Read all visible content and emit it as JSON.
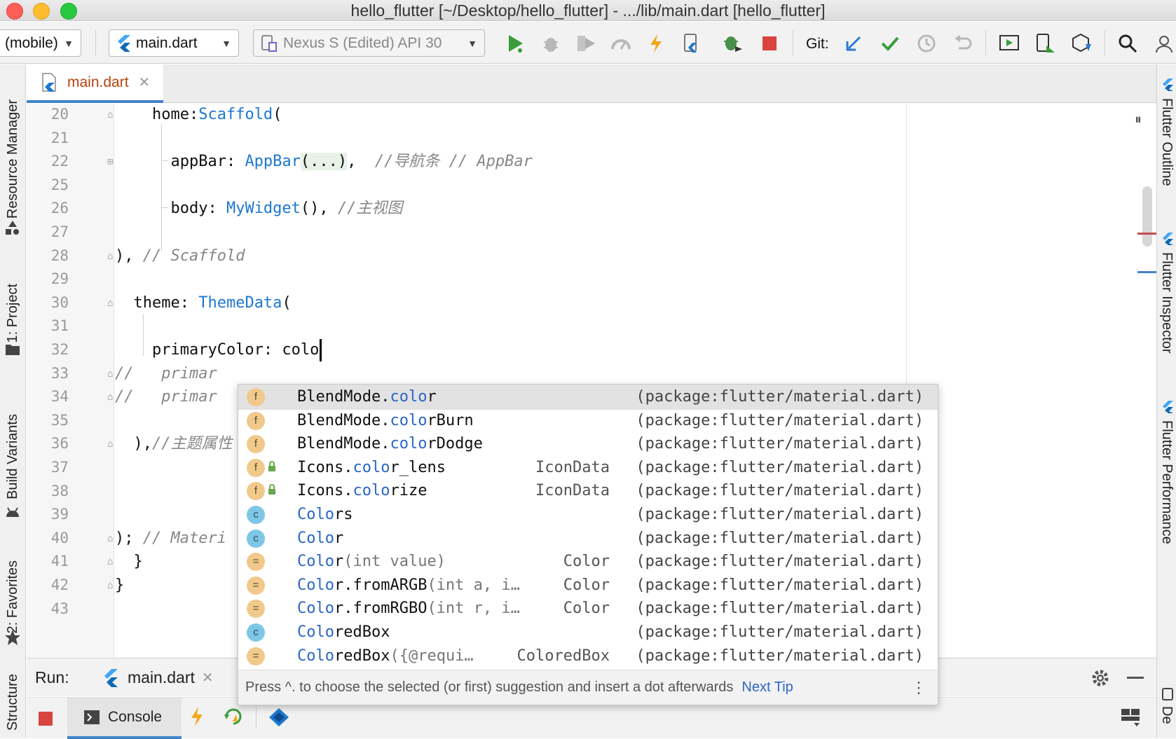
{
  "window": {
    "title": "hello_flutter [~/Desktop/hello_flutter] - .../lib/main.dart [hello_flutter]"
  },
  "toolbar": {
    "device_target": "(mobile)",
    "run_config": "main.dart",
    "device": "Nexus S (Edited) API 30",
    "git_label": "Git:",
    "icons": [
      "run-icon",
      "debug-icon",
      "coverage-icon",
      "profile-icon",
      "hot-reload-icon",
      "flutter-attach-icon",
      "debug-attach-icon",
      "stop-icon",
      "git-update-icon",
      "git-commit-icon",
      "git-history-icon",
      "git-rollback-icon",
      "presentation-icon",
      "device-manager-icon",
      "sdk-manager-icon",
      "search-icon"
    ]
  },
  "left_tools": [
    "Resource Manager",
    "1: Project",
    "Build Variants",
    "2: Favorites",
    "Structure"
  ],
  "right_tools": [
    "Flutter Outline",
    "Flutter Inspector",
    "Flutter Performance",
    "De"
  ],
  "editor": {
    "tab_label": "main.dart",
    "lines": [
      {
        "num": "20",
        "segments": [
          {
            "text": "    home:"
          },
          {
            "text": "Scaffold",
            "cls": "t"
          },
          {
            "text": "("
          }
        ]
      },
      {
        "num": "21",
        "segments": []
      },
      {
        "num": "22",
        "segments": [
          {
            "text": "      appBar: "
          },
          {
            "text": "AppBar",
            "cls": "t"
          },
          {
            "text": "(...)",
            "cls": "f"
          },
          {
            "text": ",  "
          },
          {
            "text": "//导航条 // AppBar",
            "cls": "c"
          }
        ]
      },
      {
        "num": "25",
        "segments": []
      },
      {
        "num": "26",
        "segments": [
          {
            "text": "      body: "
          },
          {
            "text": "MyWidget",
            "cls": "t"
          },
          {
            "text": "(), "
          },
          {
            "text": "//主视图",
            "cls": "c"
          }
        ]
      },
      {
        "num": "27",
        "segments": []
      },
      {
        "num": "28",
        "segments": [
          {
            "text": "), "
          },
          {
            "text": "// Scaffold",
            "cls": "c"
          }
        ]
      },
      {
        "num": "29",
        "segments": []
      },
      {
        "num": "30",
        "segments": [
          {
            "text": "  theme: "
          },
          {
            "text": "ThemeData",
            "cls": "t"
          },
          {
            "text": "("
          }
        ]
      },
      {
        "num": "31",
        "segments": []
      },
      {
        "num": "32",
        "segments": [
          {
            "text": "    primaryColor: colo"
          }
        ]
      },
      {
        "num": "33",
        "segments": [
          {
            "text": "//   ",
            "cls": "c"
          },
          {
            "text": "primar",
            "cls": "c"
          }
        ]
      },
      {
        "num": "34",
        "segments": [
          {
            "text": "//   ",
            "cls": "c"
          },
          {
            "text": "primar",
            "cls": "c"
          }
        ]
      },
      {
        "num": "35",
        "segments": []
      },
      {
        "num": "36",
        "segments": [
          {
            "text": "  ),"
          },
          {
            "text": "//主题属性",
            "cls": "c"
          }
        ]
      },
      {
        "num": "37",
        "segments": []
      },
      {
        "num": "38",
        "segments": []
      },
      {
        "num": "39",
        "segments": []
      },
      {
        "num": "40",
        "segments": [
          {
            "text": "); "
          },
          {
            "text": "// Materi",
            "cls": "c"
          }
        ]
      },
      {
        "num": "41",
        "segments": [
          {
            "text": "  }"
          }
        ]
      },
      {
        "num": "42",
        "segments": [
          {
            "text": "}"
          }
        ]
      },
      {
        "num": "43",
        "segments": []
      }
    ]
  },
  "completion": {
    "items": [
      {
        "kind": "f",
        "locked": false,
        "pre": "BlendMode.",
        "match": "colo",
        "post": "r",
        "params": "",
        "type": "",
        "pkg": "(package:flutter/material.dart)",
        "selected": true
      },
      {
        "kind": "f",
        "locked": false,
        "pre": "BlendMode.",
        "match": "colo",
        "post": "rBurn",
        "params": "",
        "type": "",
        "pkg": "(package:flutter/material.dart)"
      },
      {
        "kind": "f",
        "locked": false,
        "pre": "BlendMode.",
        "match": "colo",
        "post": "rDodge",
        "params": "",
        "type": "",
        "pkg": "(package:flutter/material.dart)"
      },
      {
        "kind": "f",
        "locked": true,
        "pre": "Icons.",
        "match": "colo",
        "post": "r_lens",
        "params": "",
        "type": "IconData",
        "pkg": "(package:flutter/material.dart)"
      },
      {
        "kind": "f",
        "locked": true,
        "pre": "Icons.",
        "match": "colo",
        "post": "rize",
        "params": "",
        "type": "IconData",
        "pkg": "(package:flutter/material.dart)"
      },
      {
        "kind": "c",
        "locked": false,
        "pre": "",
        "match": "Colo",
        "post": "rs",
        "params": "",
        "type": "",
        "pkg": "(package:flutter/material.dart)"
      },
      {
        "kind": "c",
        "locked": false,
        "pre": "",
        "match": "Colo",
        "post": "r",
        "params": "",
        "type": "",
        "pkg": "(package:flutter/material.dart)"
      },
      {
        "kind": "=",
        "locked": false,
        "pre": "",
        "match": "Colo",
        "post": "r",
        "params": "(int value)",
        "type": "Color",
        "pkg": "(package:flutter/material.dart)"
      },
      {
        "kind": "=",
        "locked": false,
        "pre": "",
        "match": "Colo",
        "post": "r.fromARGB",
        "params": "(int a, i…",
        "type": "Color",
        "pkg": "(package:flutter/material.dart)"
      },
      {
        "kind": "=",
        "locked": false,
        "pre": "",
        "match": "Colo",
        "post": "r.fromRGBO",
        "params": "(int r, i…",
        "type": "Color",
        "pkg": "(package:flutter/material.dart)"
      },
      {
        "kind": "c",
        "locked": false,
        "pre": "",
        "match": "Colo",
        "post": "redBox",
        "params": "",
        "type": "",
        "pkg": "(package:flutter/material.dart)"
      },
      {
        "kind": "=",
        "locked": false,
        "pre": "",
        "match": "Colo",
        "post": "redBox",
        "params": "({@requi…",
        "type": "ColoredBox",
        "pkg": "(package:flutter/material.dart)"
      }
    ],
    "footer_hint": "Press ^. to choose the selected (or first) suggestion and insert a dot afterwards",
    "footer_link": "Next Tip"
  },
  "run_panel": {
    "label": "Run:",
    "tab_label": "main.dart",
    "console_label": "Console"
  },
  "colors": {
    "accent": "#4083c9",
    "type_blue": "#1e77d1",
    "run_green": "#3a9d3a",
    "stop_red": "#d9443f",
    "hot_reload": "#f2a81d"
  }
}
